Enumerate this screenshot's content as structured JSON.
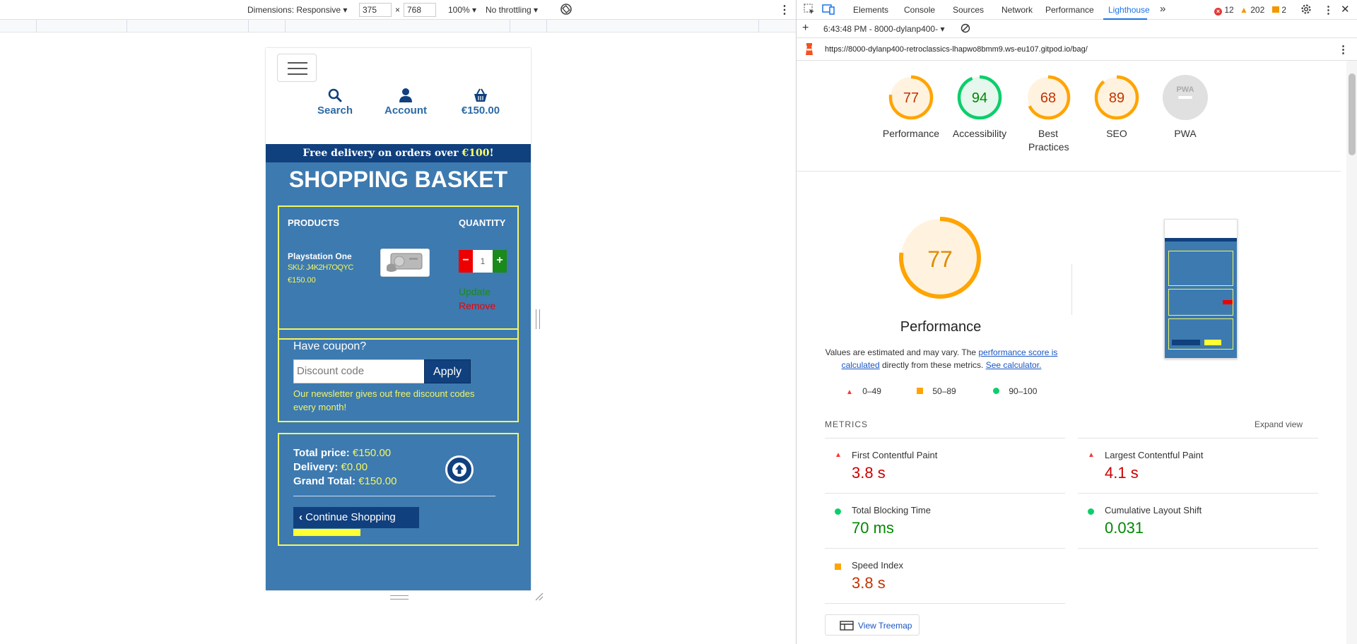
{
  "device_toolbar": {
    "dimensions_label": "Dimensions: Responsive",
    "width_value": "375",
    "times": "×",
    "height_value": "768",
    "zoom": "100%",
    "throttling": "No throttling"
  },
  "site": {
    "nav": {
      "search": "Search",
      "account": "Account",
      "basket_total": "€150.00"
    },
    "banner": {
      "prefix": "Free delivery on orders over ",
      "amount": "€100",
      "suffix": "!"
    },
    "page_title": "SHOPPING BASKET",
    "table_headers": {
      "products": "PRODUCTS",
      "quantity": "QUANTITY"
    },
    "product": {
      "name": "Playstation One",
      "sku": "SKU: J4K2H7OQYC",
      "price": "€150.00",
      "quantity": "1",
      "update": "Update",
      "remove": "Remove",
      "minus": "−",
      "plus": "+"
    },
    "coupon": {
      "title": "Have coupon?",
      "placeholder": "Discount code",
      "apply": "Apply",
      "note": "Our newsletter gives out free discount codes every month!"
    },
    "totals": {
      "total_label": "Total price:",
      "total_value": "€150.00",
      "delivery_label": "Delivery:",
      "delivery_value": "€0.00",
      "grand_label": "Grand Total:",
      "grand_value": "€150.00"
    },
    "continue_shopping": "Continue Shopping"
  },
  "devtools": {
    "tabs": [
      "Elements",
      "Console",
      "Sources",
      "Network",
      "Performance",
      "Lighthouse"
    ],
    "active_tab": "Lighthouse",
    "errors": "12",
    "warnings": "202",
    "issues": "2",
    "report_selector": "6:43:48 PM - 8000-dylanp400-",
    "url": "https://8000-dylanp400-retroclassics-lhapwo8bmm9.ws-eu107.gitpod.io/bag/"
  },
  "lighthouse": {
    "scores": [
      {
        "label": "Performance",
        "score": "77",
        "color": "#ffa400",
        "bg": "#fff3e0"
      },
      {
        "label": "Accessibility",
        "score": "94",
        "color": "#0cce6b",
        "bg": "#e6f7ee"
      },
      {
        "label": "Best Practices",
        "score": "68",
        "color": "#ffa400",
        "bg": "#fff3e0"
      },
      {
        "label": "SEO",
        "score": "89",
        "color": "#ffa400",
        "bg": "#fff3e0"
      },
      {
        "label": "PWA",
        "score": "PWA",
        "color": "#9e9e9e",
        "bg": "#e0e0e0"
      }
    ],
    "score_values": [
      77,
      94,
      68,
      89
    ],
    "main_score": "77",
    "main_title": "Performance",
    "estimate_text_1": "Values are estimated and may vary. The ",
    "estimate_link_1": "performance score is calculated",
    "estimate_text_2": " directly from these metrics. ",
    "estimate_link_2": "See calculator.",
    "legend": [
      {
        "range": "0–49",
        "shape": "triangle",
        "color": "#ff3333"
      },
      {
        "range": "50–89",
        "shape": "square",
        "color": "#ffa400"
      },
      {
        "range": "90–100",
        "shape": "circle",
        "color": "#0cce6b"
      }
    ],
    "metrics_heading": "METRICS",
    "expand_view": "Expand view",
    "metrics": [
      {
        "label": "First Contentful Paint",
        "value": "3.8 s",
        "status": "fail",
        "color": "#cc0000"
      },
      {
        "label": "Largest Contentful Paint",
        "value": "4.1 s",
        "status": "fail",
        "color": "#cc0000"
      },
      {
        "label": "Total Blocking Time",
        "value": "70 ms",
        "status": "pass",
        "color": "#008800"
      },
      {
        "label": "Cumulative Layout Shift",
        "value": "0.031",
        "status": "pass",
        "color": "#008800"
      },
      {
        "label": "Speed Index",
        "value": "3.8 s",
        "status": "average",
        "color": "#c33300"
      }
    ],
    "view_treemap": "View Treemap"
  }
}
